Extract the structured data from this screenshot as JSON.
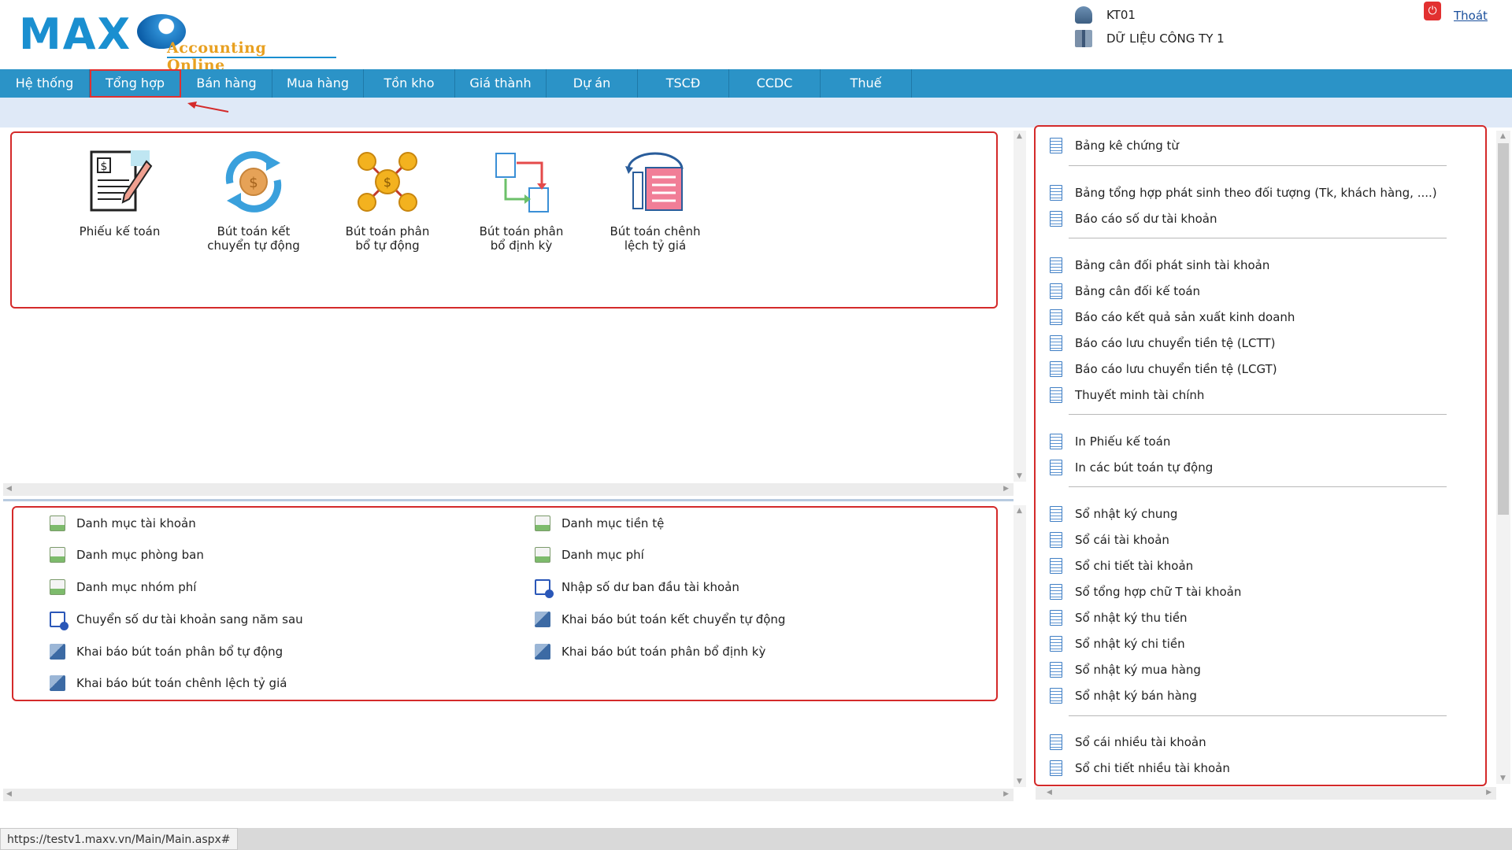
{
  "header": {
    "logo_main": "MAX",
    "logo_sub": "Accounting Online",
    "user_code": "KT01",
    "company": "DỮ LIỆU CÔNG TY 1",
    "logout_label": "Thoát"
  },
  "nav": {
    "items": [
      {
        "label": "Hệ thống"
      },
      {
        "label": "Tổng hợp"
      },
      {
        "label": "Bán hàng"
      },
      {
        "label": "Mua hàng"
      },
      {
        "label": "Tồn kho"
      },
      {
        "label": "Giá thành"
      },
      {
        "label": "Dự án"
      },
      {
        "label": "TSCĐ"
      },
      {
        "label": "CCDC"
      },
      {
        "label": "Thuế"
      }
    ],
    "active_index": 1
  },
  "tiles": [
    {
      "label": "Phiếu kế toán",
      "icon": "voucher-icon"
    },
    {
      "label": "Bút toán kết chuyển tự động",
      "icon": "auto-transfer-icon"
    },
    {
      "label": "Bút toán phân bổ tự động",
      "icon": "auto-allocation-icon"
    },
    {
      "label": "Bút toán phân bổ định kỳ",
      "icon": "periodic-allocation-icon"
    },
    {
      "label": "Bút toán chênh lệch tỷ giá",
      "icon": "exchange-diff-icon"
    }
  ],
  "categories": {
    "left": [
      {
        "label": "Danh mục tài khoản",
        "icon": "list-icon"
      },
      {
        "label": "Danh mục phòng ban",
        "icon": "list-icon"
      },
      {
        "label": "Danh mục nhóm phí",
        "icon": "list-icon"
      },
      {
        "label": "Chuyển số dư tài khoản sang năm sau",
        "icon": "transfer-icon"
      },
      {
        "label": "Khai báo bút toán phân bổ tự động",
        "icon": "cube-icon"
      },
      {
        "label": "Khai báo bút toán chênh lệch tỷ giá",
        "icon": "cube-icon"
      }
    ],
    "right": [
      {
        "label": "Danh mục tiền tệ",
        "icon": "list-icon"
      },
      {
        "label": "Danh mục phí",
        "icon": "list-icon"
      },
      {
        "label": "Nhập số dư ban đầu tài khoản",
        "icon": "transfer-icon"
      },
      {
        "label": "Khai báo bút toán kết chuyển tự động",
        "icon": "cube-icon"
      },
      {
        "label": "Khai báo bút toán phân bổ định kỳ",
        "icon": "cube-icon"
      }
    ]
  },
  "reports": {
    "groups": [
      [
        "Bảng kê chứng từ"
      ],
      [
        "Bảng tổng hợp phát sinh theo đối tượng (Tk, khách hàng, ....)",
        "Báo cáo số dư tài khoản"
      ],
      [
        "Bảng cân đối phát sinh tài khoản",
        "Bảng cân đối kế toán",
        "Báo cáo kết quả sản xuất kinh doanh",
        "Báo cáo lưu chuyển tiền tệ (LCTT)",
        "Báo cáo lưu chuyển tiền tệ (LCGT)",
        "Thuyết minh tài chính"
      ],
      [
        "In Phiếu kế toán",
        "In các bút toán tự động"
      ],
      [
        "Sổ nhật ký chung",
        "Sổ cái tài khoản",
        "Sổ chi tiết tài khoản",
        "Sổ tổng hợp chữ T tài khoản",
        "Sổ nhật ký thu tiền",
        "Sổ nhật ký chi tiền",
        "Sổ nhật ký mua hàng",
        "Sổ nhật ký bán hàng"
      ],
      [
        "Sổ cái nhiều tài khoản",
        "Sổ chi tiết nhiều tài khoản"
      ]
    ]
  },
  "status": {
    "url": "https://testv1.maxv.vn/Main/Main.aspx#"
  }
}
